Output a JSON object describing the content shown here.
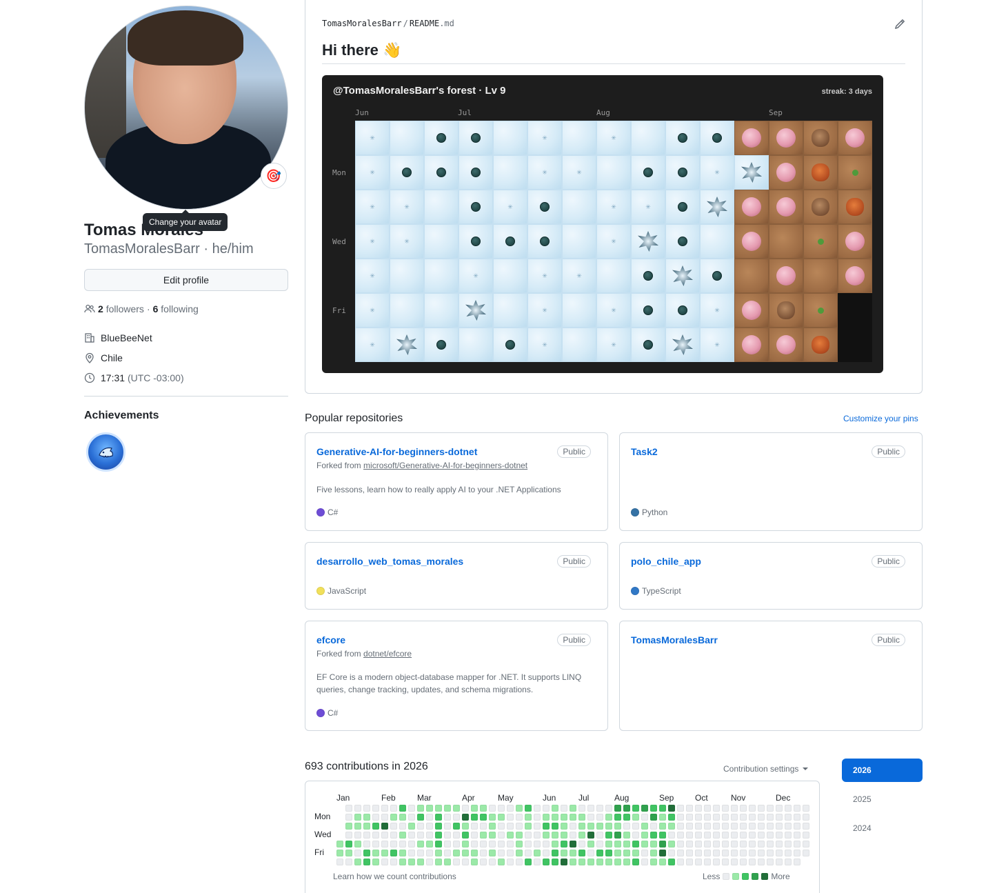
{
  "profile": {
    "full_name": "Tomas Morales",
    "username_line": "TomasMoralesBarr · he/him",
    "avatar_tooltip": "Change your avatar",
    "edit_profile_label": "Edit profile",
    "followers_count": "2",
    "followers_label": "followers",
    "following_count": "6",
    "following_label": "following",
    "company": "BlueBeeNet",
    "location": "Chile",
    "local_time": "17:31",
    "timezone": "(UTC -03:00)",
    "achievements_title": "Achievements"
  },
  "readme": {
    "path_user": "TomasMoralesBarr",
    "path_sep": "/",
    "path_file_base": "README",
    "path_file_ext": ".md",
    "heading": "Hi there 👋",
    "forest": {
      "title": "@TomasMoralesBarr's forest · Lv 9",
      "streak": "streak: 3 days",
      "months": [
        "Jun",
        "Jul",
        "Aug",
        "Sep"
      ],
      "days": [
        "Mon",
        "Wed",
        "Fri"
      ]
    }
  },
  "popular": {
    "title": "Popular repositories",
    "customize_label": "Customize your pins",
    "repos": [
      {
        "name": "Generative-AI-for-beginners-dotnet",
        "visibility": "Public",
        "fork_prefix": "Forked from",
        "fork_source": "microsoft/Generative-AI-for-beginners-dotnet",
        "description": "Five lessons, learn how to really apply AI to your .NET Applications",
        "language": "C#",
        "lang_color": "#6e4dd6"
      },
      {
        "name": "Task2",
        "visibility": "Public",
        "language": "Python",
        "lang_color": "#3572A5"
      },
      {
        "name": "desarrollo_web_tomas_morales",
        "visibility": "Public",
        "language": "JavaScript",
        "lang_color": "#f1e05a"
      },
      {
        "name": "polo_chile_app",
        "visibility": "Public",
        "language": "TypeScript",
        "lang_color": "#3178c6"
      },
      {
        "name": "efcore",
        "visibility": "Public",
        "fork_prefix": "Forked from",
        "fork_source": "dotnet/efcore",
        "description": "EF Core is a modern object-database mapper for .NET. It supports LINQ queries, change tracking, updates, and schema migrations.",
        "language": "C#",
        "lang_color": "#6e4dd6"
      },
      {
        "name": "TomasMoralesBarr",
        "visibility": "Public"
      }
    ]
  },
  "contributions": {
    "title": "693 contributions in 2026",
    "settings_label": "Contribution settings",
    "months": [
      "Jan",
      "Feb",
      "Mar",
      "Apr",
      "May",
      "Jun",
      "Jul",
      "Aug",
      "Sep",
      "Oct",
      "Nov",
      "Dec"
    ],
    "days": [
      "Mon",
      "Wed",
      "Fri"
    ],
    "learn_label": "Learn how we count contributions",
    "legend_less": "Less",
    "legend_more": "More",
    "years": [
      "2026",
      "2025",
      "2024"
    ],
    "selected_year": "2026",
    "colors": {
      "lv0": "#ebedf0",
      "lv1": "#9be9a8",
      "lv2": "#40c463",
      "lv3": "#30a14e",
      "lv4": "#216e39"
    }
  }
}
